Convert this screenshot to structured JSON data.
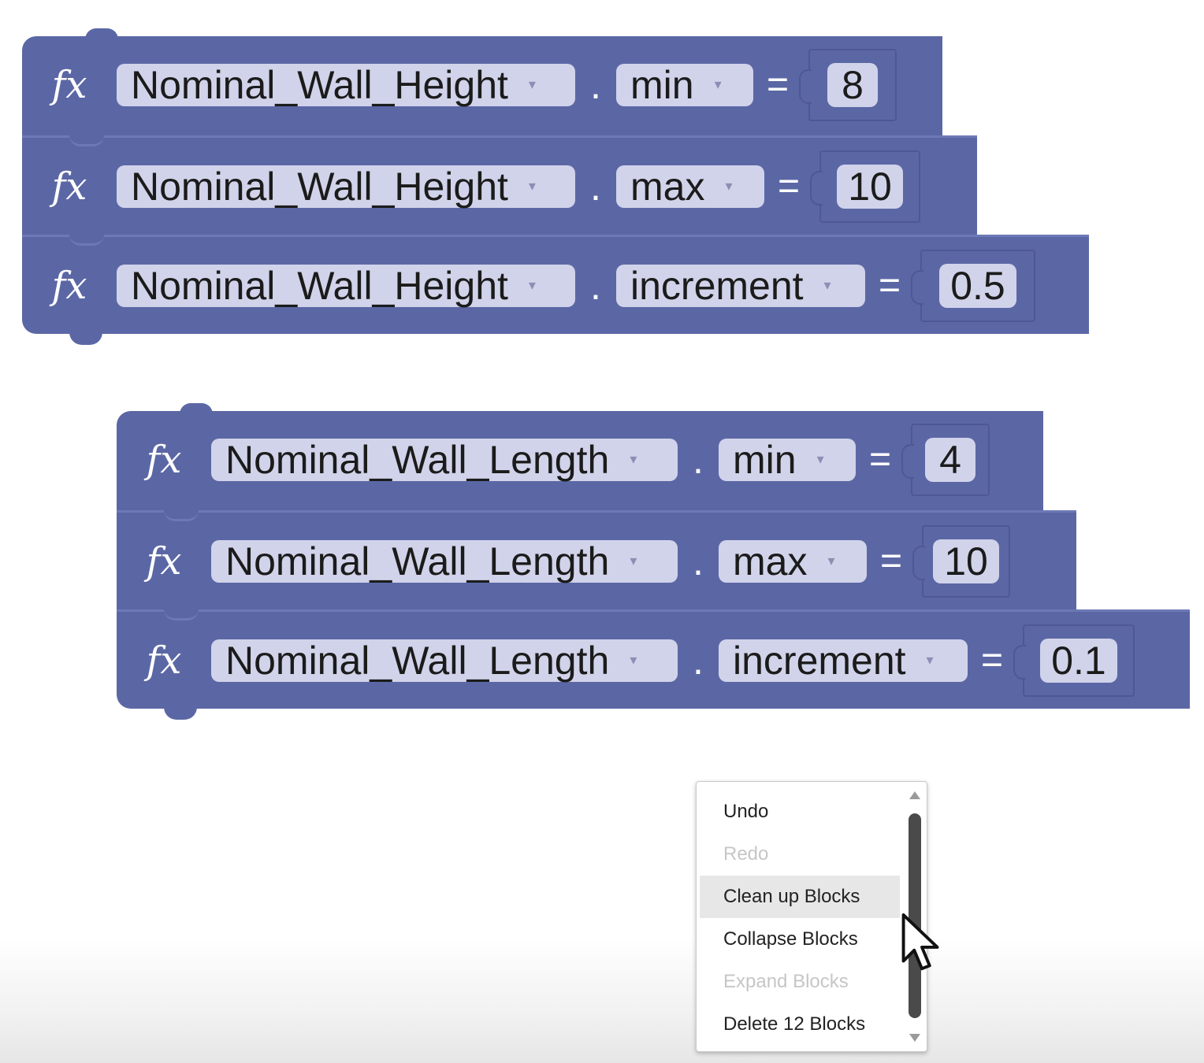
{
  "groups": [
    {
      "rows": [
        {
          "fx": "fx",
          "variable": "Nominal_Wall_Height",
          "dot": ".",
          "property": "min",
          "eq": "=",
          "value": "8"
        },
        {
          "fx": "fx",
          "variable": "Nominal_Wall_Height",
          "dot": ".",
          "property": "max",
          "eq": "=",
          "value": "10"
        },
        {
          "fx": "fx",
          "variable": "Nominal_Wall_Height",
          "dot": ".",
          "property": "increment",
          "eq": "=",
          "value": "0.5"
        }
      ]
    },
    {
      "rows": [
        {
          "fx": "fx",
          "variable": "Nominal_Wall_Length",
          "dot": ".",
          "property": "min",
          "eq": "=",
          "value": "4"
        },
        {
          "fx": "fx",
          "variable": "Nominal_Wall_Length",
          "dot": ".",
          "property": "max",
          "eq": "=",
          "value": "10"
        },
        {
          "fx": "fx",
          "variable": "Nominal_Wall_Length",
          "dot": ".",
          "property": "increment",
          "eq": "=",
          "value": "0.1"
        }
      ]
    }
  ],
  "dropdown_arrow": "▾",
  "context_menu": {
    "items": [
      {
        "label": "Undo",
        "enabled": true
      },
      {
        "label": "Redo",
        "enabled": false
      },
      {
        "label": "Clean up Blocks",
        "enabled": true,
        "hovered": true
      },
      {
        "label": "Collapse Blocks",
        "enabled": true
      },
      {
        "label": "Expand Blocks",
        "enabled": false
      },
      {
        "label": "Delete 12 Blocks",
        "enabled": true
      }
    ]
  },
  "colors": {
    "block": "#5b67a5",
    "field": "#d1d3ea",
    "menu_hover": "#e7e7e7"
  }
}
